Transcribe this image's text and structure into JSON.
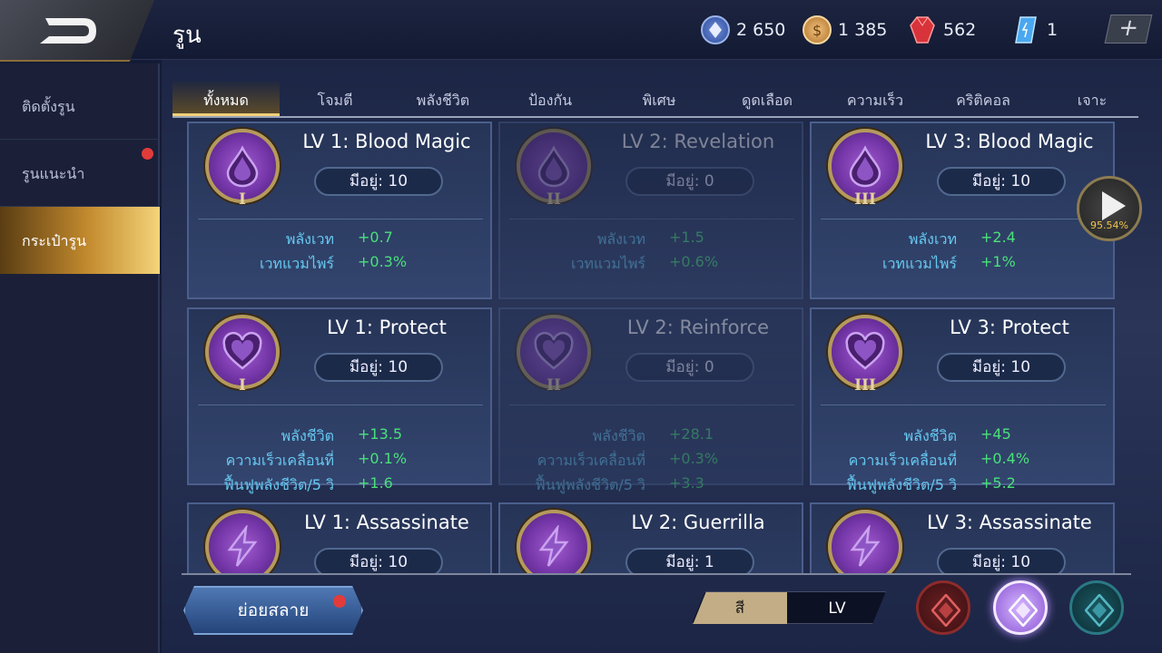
{
  "header": {
    "title": "รูน",
    "currencies": [
      {
        "icon": "blue-voucher-icon",
        "value": "2 650"
      },
      {
        "icon": "gold-coin-icon",
        "value": "1 385"
      },
      {
        "icon": "red-gem-icon",
        "value": "562"
      },
      {
        "icon": "blue-crystal-icon",
        "value": "1"
      }
    ],
    "add_label": "+"
  },
  "sidebar": {
    "items": [
      {
        "label": "ติดตั้งรูน"
      },
      {
        "label": "รูนแนะนำ"
      },
      {
        "label": "กระเป๋ารูน"
      }
    ],
    "active_index": 2
  },
  "tabs": [
    {
      "label": "ทั้งหมด"
    },
    {
      "label": "โจมตี"
    },
    {
      "label": "พลังชีวิต"
    },
    {
      "label": "ป้องกัน"
    },
    {
      "label": "พิเศษ"
    },
    {
      "label": "ดูดเลือด"
    },
    {
      "label": "ความเร็ว"
    },
    {
      "label": "คริติคอล"
    },
    {
      "label": "เจาะ"
    }
  ],
  "active_tab": 0,
  "runes": [
    {
      "name": "LV 1: Blood Magic",
      "roman": "I",
      "owned": "มีอยู่: 10",
      "icon": "droplet-icon",
      "dim": false,
      "stats": [
        {
          "label": "พลังเวท",
          "value": "+0.7"
        },
        {
          "label": "เวทแวมไพร์",
          "value": "+0.3%"
        }
      ]
    },
    {
      "name": "LV 2: Revelation",
      "roman": "II",
      "owned": "มีอยู่: 0",
      "icon": "droplet-icon",
      "dim": true,
      "stats": [
        {
          "label": "พลังเวท",
          "value": "+1.5"
        },
        {
          "label": "เวทแวมไพร์",
          "value": "+0.6%"
        }
      ]
    },
    {
      "name": "LV 3: Blood Magic",
      "roman": "III",
      "owned": "มีอยู่: 10",
      "icon": "droplet-icon",
      "dim": false,
      "stats": [
        {
          "label": "พลังเวท",
          "value": "+2.4"
        },
        {
          "label": "เวทแวมไพร์",
          "value": "+1%"
        }
      ]
    },
    {
      "name": "LV 1: Protect",
      "roman": "I",
      "owned": "มีอยู่: 10",
      "icon": "heart-icon",
      "dim": false,
      "stats": [
        {
          "label": "พลังชีวิต",
          "value": "+13.5"
        },
        {
          "label": "ความเร็วเคลื่อนที่",
          "value": "+0.1%"
        },
        {
          "label": "ฟื้นฟูพลังชีวิต/5 วิ",
          "value": "+1.6"
        }
      ]
    },
    {
      "name": "LV 2: Reinforce",
      "roman": "II",
      "owned": "มีอยู่: 0",
      "icon": "heart-icon",
      "dim": true,
      "stats": [
        {
          "label": "พลังชีวิต",
          "value": "+28.1"
        },
        {
          "label": "ความเร็วเคลื่อนที่",
          "value": "+0.3%"
        },
        {
          "label": "ฟื้นฟูพลังชีวิต/5 วิ",
          "value": "+3.3"
        }
      ]
    },
    {
      "name": "LV 3: Protect",
      "roman": "III",
      "owned": "มีอยู่: 10",
      "icon": "heart-icon",
      "dim": false,
      "stats": [
        {
          "label": "พลังชีวิต",
          "value": "+45"
        },
        {
          "label": "ความเร็วเคลื่อนที่",
          "value": "+0.4%"
        },
        {
          "label": "ฟื้นฟูพลังชีวิต/5 วิ",
          "value": "+5.2"
        }
      ]
    },
    {
      "name": "LV 1: Assassinate",
      "roman": "I",
      "owned": "มีอยู่: 10",
      "icon": "lightning-icon",
      "dim": false,
      "stats": []
    },
    {
      "name": "LV 2: Guerrilla",
      "roman": "II",
      "owned": "มีอยู่: 1",
      "icon": "lightning-icon",
      "dim": false,
      "stats": []
    },
    {
      "name": "LV 3: Assassinate",
      "roman": "III",
      "owned": "มีอยู่: 10",
      "icon": "lightning-icon",
      "dim": false,
      "stats": []
    }
  ],
  "footer": {
    "dismantle_label": "ย่อยสลาย",
    "sort_color_label": "สี",
    "sort_lv_label": "LV",
    "filters": [
      {
        "icon": "red-rune-filter-icon"
      },
      {
        "icon": "purple-rune-filter-icon"
      },
      {
        "icon": "teal-rune-filter-icon"
      }
    ]
  },
  "overlay": {
    "play_percent": "95.54%"
  },
  "colors": {
    "accent_gold": "#f0cf7a",
    "stat_label": "#66c8f0",
    "stat_value": "#4ae07a",
    "badge_red": "#e23b3b"
  }
}
